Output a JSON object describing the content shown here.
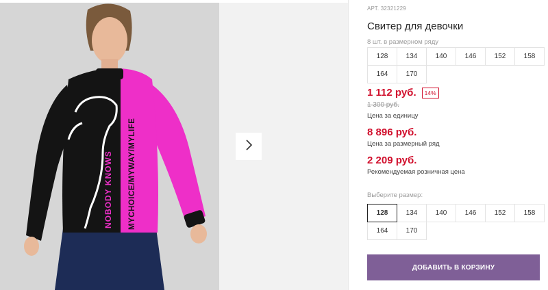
{
  "product": {
    "article": "АРТ. 32321229",
    "title": "Свитер для девочки",
    "size_row_note": "8 шт. в размерном ряду",
    "size_row": [
      "128",
      "134",
      "140",
      "146",
      "152",
      "158",
      "164",
      "170"
    ]
  },
  "pricing": {
    "unit_price": "1 112 руб.",
    "discount_badge": "14%",
    "old_price": "1 300 руб.",
    "unit_price_label": "Цена за единицу",
    "row_price": "8 896 руб.",
    "row_price_label": "Цена за размерный ряд",
    "retail_price": "2 209 руб.",
    "retail_price_label": "Рекомендуемая розничная цена"
  },
  "size_select": {
    "label": "Выберите размер:",
    "options": [
      "128",
      "134",
      "140",
      "146",
      "152",
      "158",
      "164",
      "170"
    ],
    "selected": "128"
  },
  "cart": {
    "button_label": "ДОБАВИТЬ В КОРЗИНУ"
  },
  "gallery": {
    "photo_text_left": "NOBODY KNOWS",
    "photo_text_right": "MYCHOICE/MYWAY/MYLIFE",
    "next_icon": "chevron-right-icon"
  },
  "colors": {
    "price_red": "#d1102d",
    "button_purple": "#7f5f97",
    "sweater_pink": "#ee2fc8",
    "sweater_black": "#141414",
    "jeans_blue": "#1d2c56"
  }
}
